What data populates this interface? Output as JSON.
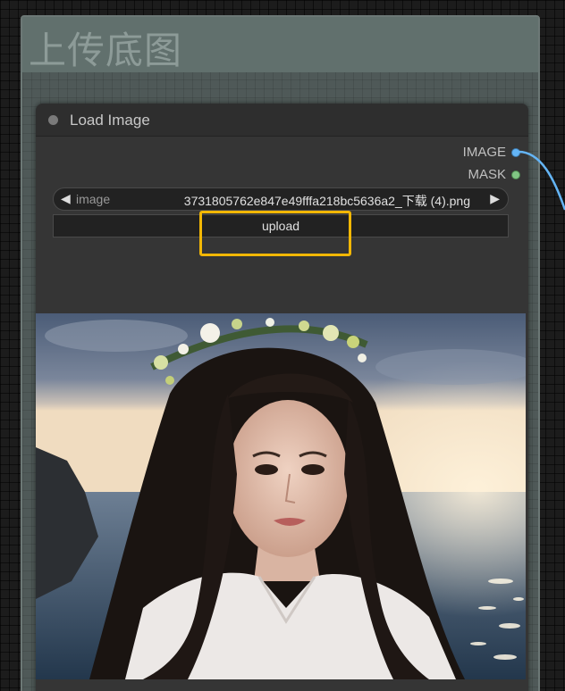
{
  "group": {
    "title": "上传底图"
  },
  "node": {
    "title": "Load Image",
    "outputs": [
      {
        "label": "IMAGE",
        "color": "#64b5f6"
      },
      {
        "label": "MASK",
        "color": "#81c784"
      }
    ],
    "image_widget": {
      "name": "image",
      "value": "3731805762e847e49fffa218bc5636a2_下载 (4).png",
      "left_arrow": "◀",
      "right_arrow": "▶"
    },
    "upload_label": "upload"
  },
  "colors": {
    "highlight": "#f2b705",
    "link": "#64b5f6"
  }
}
